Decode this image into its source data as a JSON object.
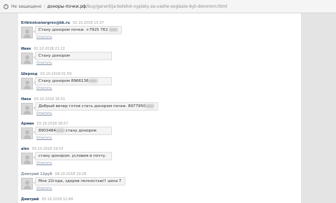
{
  "addressbar": {
    "security_text": "Не защищено",
    "domain": "доноры-почки.рф",
    "path": "/buy/garantija-bolshoi-vyplaty-za-vashe-soglasie-byt-donorom.html"
  },
  "comments": [
    {
      "author": "Erikinnicenergrov@bk.ru",
      "date": "02.10.2018 15:37",
      "text_before": "Стану донором почки. +7925 762",
      "text_after": "",
      "reply": "Ответить"
    },
    {
      "author": "Иван",
      "date": "02.10.2018 21:22",
      "text_before": "Стану донором",
      "text_after": "",
      "reply": "Ответить"
    },
    {
      "author": "Шерзод",
      "date": "03.10.2018 01:59",
      "text_before": "Стану донором 8966136",
      "text_after": "",
      "reply": "Ответить"
    },
    {
      "author": "Нике",
      "date": "03.10.2018 16:51",
      "text_before": "Добрый вечер готов стать донором почки. 8977950",
      "text_after": "",
      "reply": "Ответить"
    },
    {
      "author": "Армин",
      "date": "03.10.2018 18:57",
      "text_before": "8903484",
      "text_after": "стану донором",
      "reply": "Ответить"
    },
    {
      "author": "alex",
      "date": "03.10.2018 19:53",
      "text_before": "стану донором. условия в почту.",
      "text_after": "",
      "reply": "Ответить"
    },
    {
      "author": "Дмитрий 12руб",
      "date": "04.10.2018 19:28",
      "text_before": "Мне 22года, здоров полностью!! цена 7",
      "text_after": "",
      "reply": "Ответить"
    },
    {
      "author": "Дмитрий",
      "date": "05.10.2018 12:49",
      "text_before": "",
      "text_after": "",
      "reply": ""
    }
  ]
}
